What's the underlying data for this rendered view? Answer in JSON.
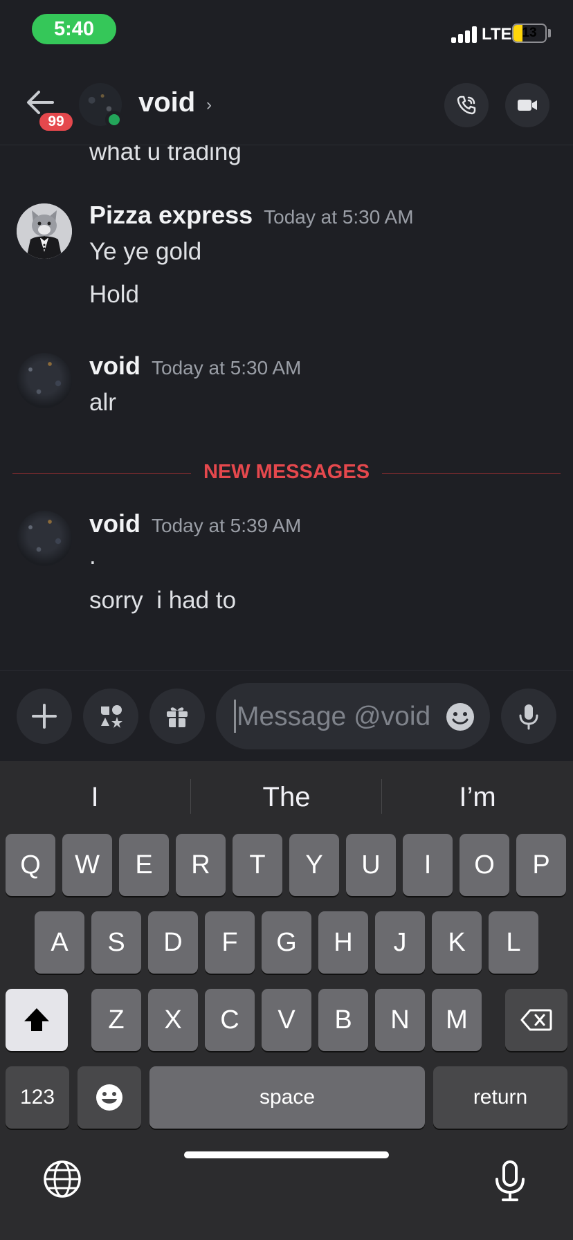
{
  "status_bar": {
    "time": "5:40",
    "network": "LTE",
    "battery": "13",
    "battery_level": 0.13,
    "colors": {
      "time_pill": "#35c759",
      "battery": "#ffd60a"
    }
  },
  "header": {
    "title": "void",
    "chevron": "›",
    "unread_count": "99",
    "icons": [
      "back-arrow-icon",
      "phone-call-icon",
      "video-camera-icon"
    ]
  },
  "messages": {
    "clipped_line": "what u trading",
    "groups": [
      {
        "author": "Pizza express",
        "timestamp": "Today at 5:30 AM",
        "lines": [
          "Ye ye gold",
          "Hold"
        ]
      },
      {
        "author": "void",
        "timestamp": "Today at 5:30 AM",
        "lines": [
          "alr"
        ]
      },
      {
        "author": "void",
        "timestamp": "Today at 5:39 AM",
        "lines": [
          ".",
          "sorry  i had to"
        ]
      }
    ],
    "divider": "NEW MESSAGES",
    "divider_color": "#e5484d"
  },
  "composer": {
    "placeholder": "Message @void",
    "icons": [
      "plus-icon",
      "apps-icon",
      "gift-icon",
      "emoji-icon",
      "microphone-icon"
    ]
  },
  "keyboard": {
    "suggestions": [
      "I",
      "The",
      "I’m"
    ],
    "row1": [
      "Q",
      "W",
      "E",
      "R",
      "T",
      "Y",
      "U",
      "I",
      "O",
      "P"
    ],
    "row2": [
      "A",
      "S",
      "D",
      "F",
      "G",
      "H",
      "J",
      "K",
      "L"
    ],
    "row3": [
      "Z",
      "X",
      "C",
      "V",
      "B",
      "N",
      "M"
    ],
    "numbers_key": "123",
    "space_key": "space",
    "return_key": "return",
    "icons": [
      "shift-icon",
      "backspace-icon",
      "emoji-keyboard-icon",
      "globe-icon",
      "dictation-mic-icon"
    ]
  }
}
